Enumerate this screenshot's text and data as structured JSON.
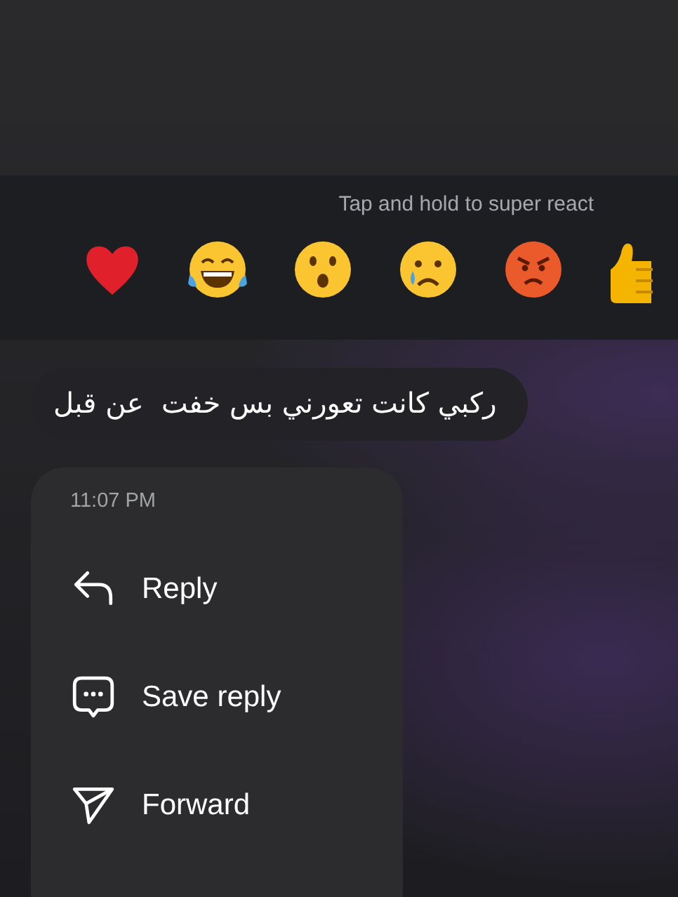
{
  "reaction_bar": {
    "hint": "Tap and hold to super react",
    "reactions": [
      {
        "kind": "heart"
      },
      {
        "kind": "laugh"
      },
      {
        "kind": "wow"
      },
      {
        "kind": "sad"
      },
      {
        "kind": "angry"
      },
      {
        "kind": "like"
      }
    ]
  },
  "message": {
    "text": "ركبي كانت تعورني بس خفت  عن قبل"
  },
  "menu": {
    "time": "11:07 PM",
    "items": [
      {
        "kind": "reply",
        "label": "Reply"
      },
      {
        "kind": "save",
        "label": "Save reply"
      },
      {
        "kind": "forward",
        "label": "Forward"
      }
    ]
  }
}
